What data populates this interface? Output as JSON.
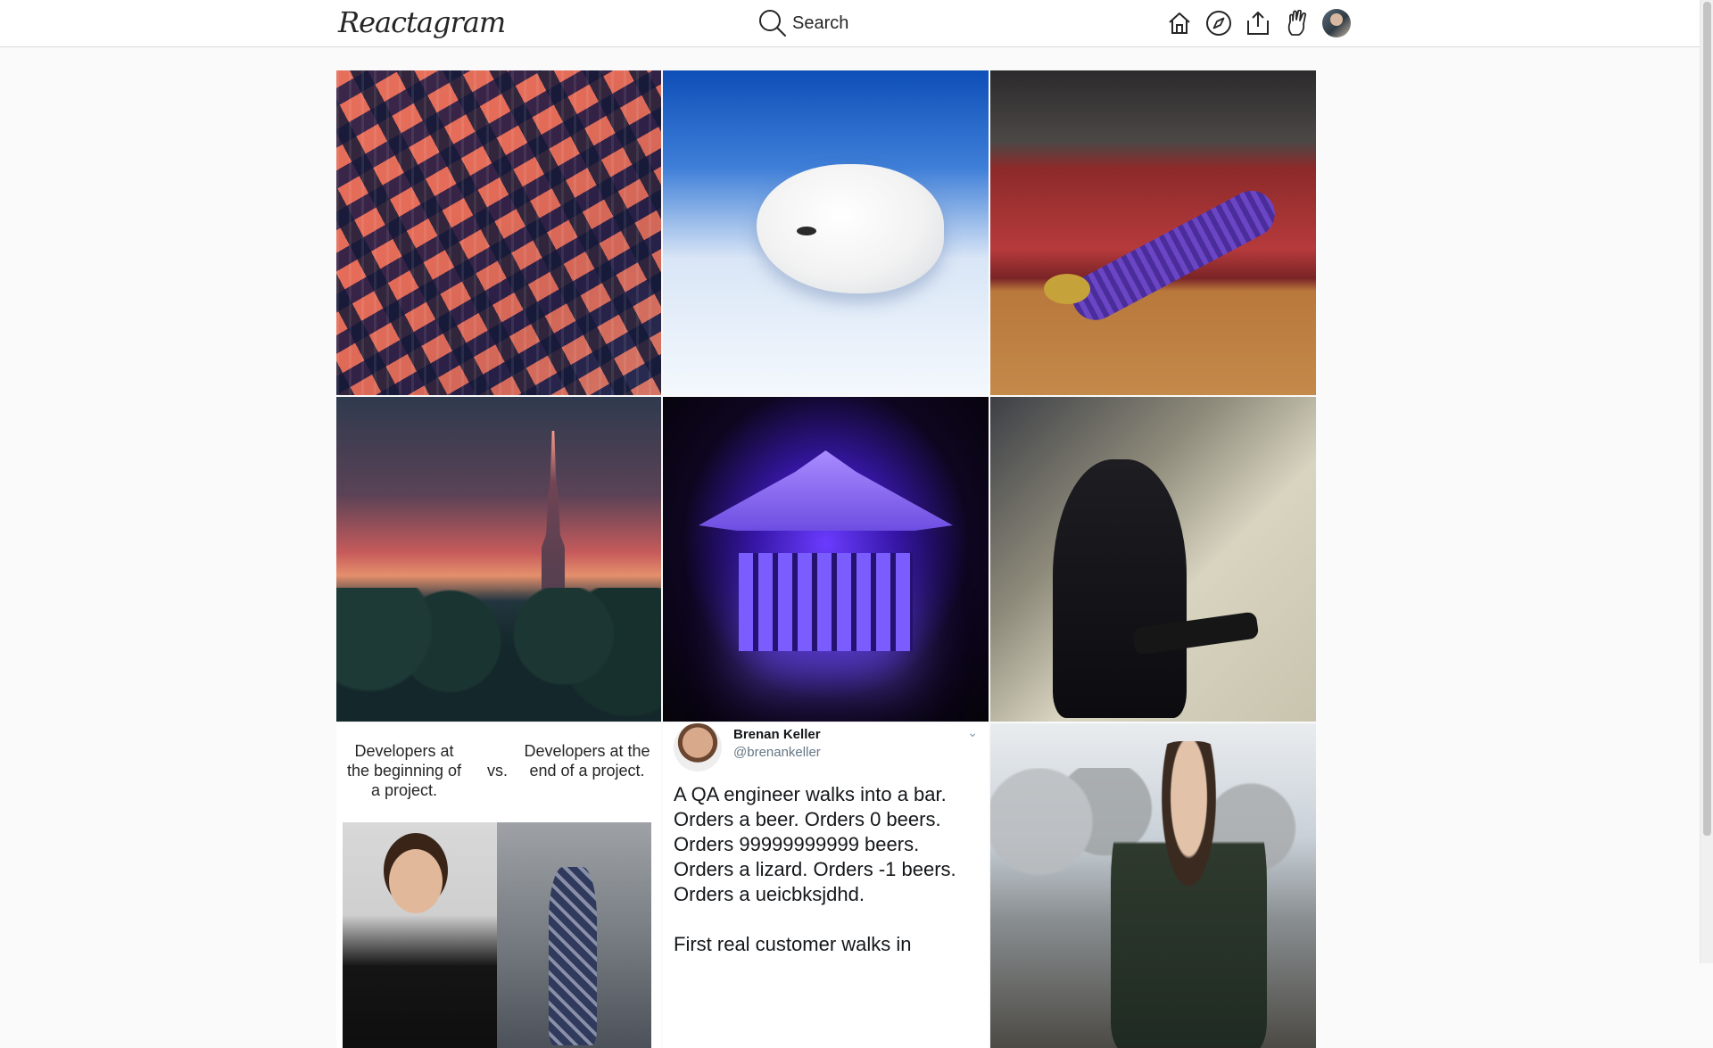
{
  "app": {
    "logo": "Reactagram"
  },
  "search": {
    "label": "Search"
  },
  "nav": {
    "icons": [
      "home-icon",
      "explore-compass-icon",
      "upload-icon",
      "activity-icon",
      "profile-avatar"
    ]
  },
  "grid": {
    "tiles": [
      {
        "name": "photo-isometric-city"
      },
      {
        "name": "photo-baby-seal"
      },
      {
        "name": "photo-snake-in-sock"
      },
      {
        "name": "photo-empire-state-dusk"
      },
      {
        "name": "photo-purple-temple"
      },
      {
        "name": "photo-darth-vader"
      },
      {
        "name": "photo-developer-meme"
      },
      {
        "name": "photo-tweet-screenshot"
      },
      {
        "name": "photo-man-winter"
      }
    ]
  },
  "meme": {
    "left_text": "Developers at the beginning of a project.",
    "vs_text": "vs.",
    "right_text": "Developers at the end of a project."
  },
  "tweet": {
    "author_name": "Brenan Keller",
    "author_handle": "@brenankeller",
    "body": "A QA engineer walks into a bar. Orders a beer. Orders 0 beers. Orders 99999999999 beers. Orders a lizard. Orders -1 beers. Orders a ueicbksjdhd.\n\nFirst real customer walks in"
  },
  "colors": {
    "header_bg": "#ffffff",
    "page_bg": "#fafafa",
    "border": "#dbdbdb",
    "text": "#262626"
  }
}
